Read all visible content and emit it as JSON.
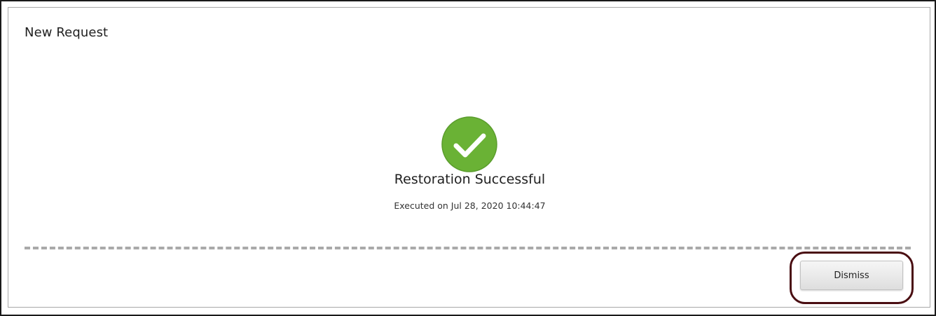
{
  "dialog": {
    "title": "New Request"
  },
  "status": {
    "icon": "check-circle-icon",
    "color": "#6ab235",
    "title": "Restoration Successful",
    "executed_text": "Executed on Jul 28, 2020 10:44:47"
  },
  "footer": {
    "dismiss_label": "Dismiss",
    "highlight_color": "#4a0e12"
  }
}
